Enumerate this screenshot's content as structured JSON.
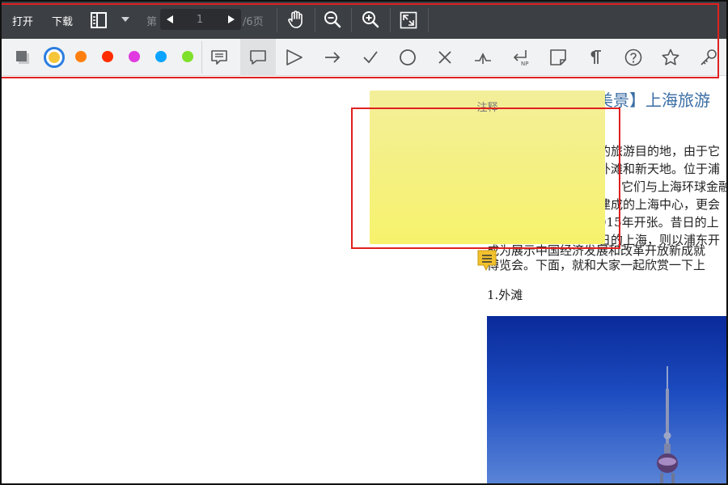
{
  "toolbar": {
    "open_label": "打开",
    "download_label": "下载",
    "page_prefix": "第",
    "page_current": "1",
    "page_total_suffix": "/6页",
    "icons": [
      "sidebar-toggle-icon",
      "chevron-down-icon",
      "prev-page-icon",
      "next-page-icon",
      "hand-pan-icon",
      "zoom-out-icon",
      "zoom-in-icon",
      "fullscreen-icon"
    ]
  },
  "annotation_toolbar": {
    "color_swatches": [
      "#f5c53a",
      "#ff7f0e",
      "#ff2d00",
      "#e03ae0",
      "#0aa4ff",
      "#7ee02b"
    ],
    "selected_color": "#f5c53a",
    "tools": [
      "layers-icon",
      "color-palette",
      "comment-icon",
      "speech-bubble-icon",
      "send-arrow-icon",
      "arrow-right-icon",
      "checkmark-icon",
      "circle-icon",
      "cross-icon",
      "insert-text-icon",
      "new-paragraph-icon",
      "sticky-note-icon",
      "paragraph-icon",
      "help-icon",
      "star-icon",
      "key-icon"
    ]
  },
  "note": {
    "title": "注释"
  },
  "document": {
    "title": "美景】上海旅游",
    "lines": [
      "的旅游目的地，由于它",
      "外滩和新天地。位于浦",
      "它们与上海环球金融",
      "建成的上海中心，更会",
      "015年开张。昔日的上",
      "日的上海，则以浦东开",
      "成为展示中国经济发展和改革开放新成就",
      "博览会。下面，就和大家一起欣赏一下上"
    ],
    "section_heading": "1.外滩"
  },
  "colors": {
    "toolbar_dark": "#3c3f43",
    "toolbar_light": "#f1f2f3",
    "highlight_red": "#e02020",
    "note_yellow": "#f7f26c",
    "title_blue": "#3a6ea5"
  }
}
